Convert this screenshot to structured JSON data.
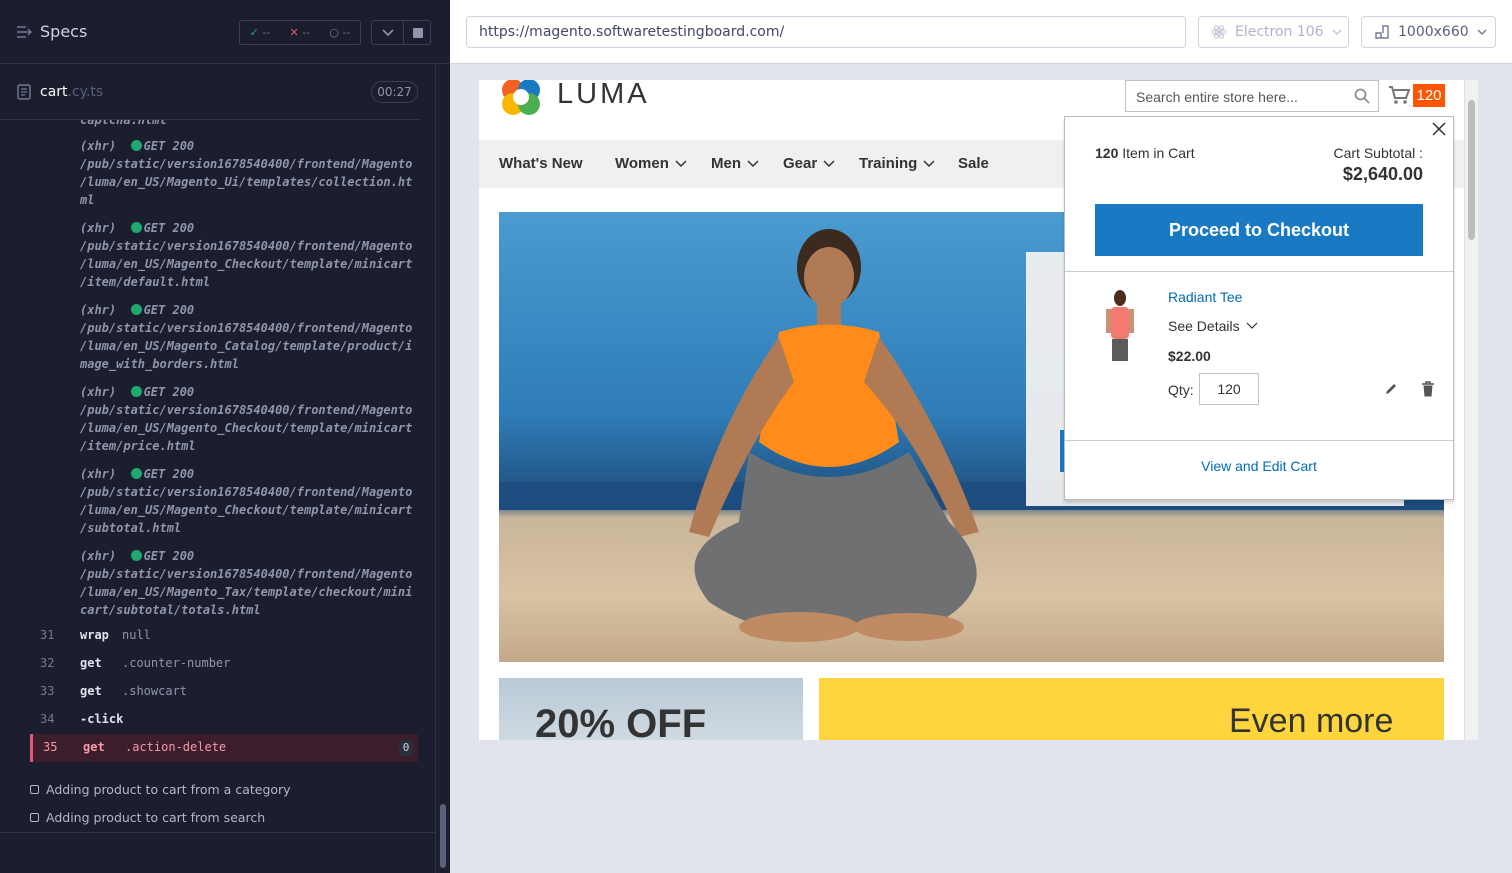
{
  "runner": {
    "specs_label": "Specs",
    "stats": {
      "passed": "--",
      "failed": "--",
      "pending": "--"
    },
    "file": {
      "name": "cart",
      "ext": ".cy.ts",
      "time": "00:27"
    },
    "logs": [
      {
        "prefix": "(xhr)",
        "status": "GET 200",
        "path": "/pub/static/version1678540400/frontend/Magento\n/luma/en_US/Magento_Ui/templates/collection.ht\nml"
      },
      {
        "prefix": "(xhr)",
        "status": "GET 200",
        "path": "/pub/static/version1678540400/frontend/Magento\n/luma/en_US/Magento_Checkout/template/minicart\n/item/default.html"
      },
      {
        "prefix": "(xhr)",
        "status": "GET 200",
        "path": "/pub/static/version1678540400/frontend/Magento\n/luma/en_US/Magento_Catalog/template/product/i\nmage_with_borders.html"
      },
      {
        "prefix": "(xhr)",
        "status": "GET 200",
        "path": "/pub/static/version1678540400/frontend/Magento\n/luma/en_US/Magento_Checkout/template/minicart\n/item/price.html"
      },
      {
        "prefix": "(xhr)",
        "status": "GET 200",
        "path": "/pub/static/version1678540400/frontend/Magento\n/luma/en_US/Magento_Checkout/template/minicart\n/subtotal.html"
      },
      {
        "prefix": "(xhr)",
        "status": "GET 200",
        "path": "/pub/static/version1678540400/frontend/Magento\n/luma/en_US/Magento_Tax/template/checkout/mini\ncart/subtotal/totals.html"
      }
    ],
    "top_cut": "captcha.html",
    "commands": [
      {
        "num": "31",
        "cmd": "wrap",
        "arg": "null"
      },
      {
        "num": "32",
        "cmd": "get",
        "arg": ".counter-number"
      },
      {
        "num": "33",
        "cmd": "get",
        "arg": ".showcart"
      },
      {
        "num": "34",
        "cmd": "-click",
        "arg": ""
      },
      {
        "num": "35",
        "cmd": "get",
        "arg": ".action-delete",
        "badge": "0"
      }
    ],
    "tests": [
      "Adding product to cart from a category",
      "Adding product to cart from search"
    ]
  },
  "aut": {
    "url": "https://magento.softwaretestingboard.com/",
    "browser": "Electron 106",
    "viewport": "1000x660"
  },
  "site": {
    "logo": "LUMA",
    "search_placeholder": "Search entire store here...",
    "cart_count": "120",
    "nav": [
      "What's New",
      "Women",
      "Men",
      "Gear",
      "Training",
      "Sale"
    ],
    "promo1": "20% OFF",
    "promo2": "Even more",
    "minicart": {
      "count": "120",
      "count_label": "Item in Cart",
      "subtotal_label": "Cart Subtotal :",
      "subtotal": "$2,640.00",
      "checkout": "Proceed to Checkout",
      "product": "Radiant Tee",
      "see_details": "See Details",
      "price": "$22.00",
      "qty_label": "Qty:",
      "qty": "120",
      "view_cart": "View and Edit Cart"
    }
  }
}
